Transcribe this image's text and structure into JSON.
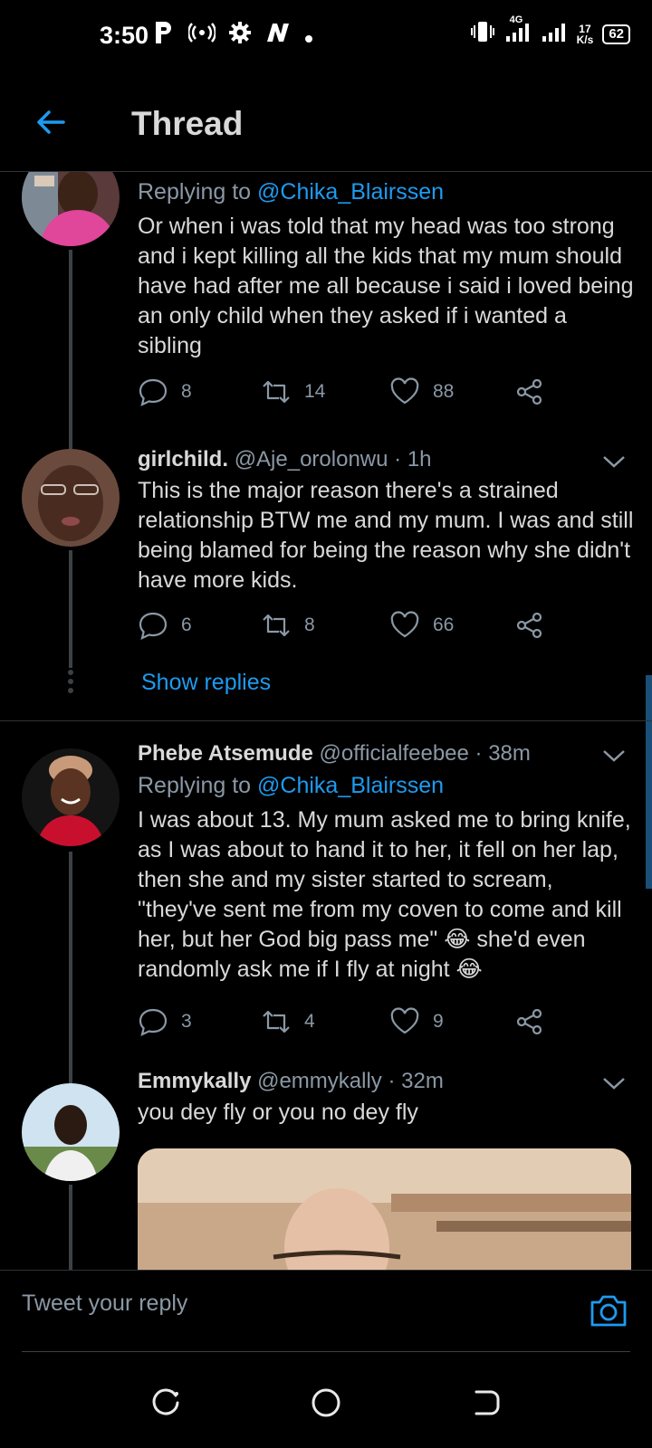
{
  "status_bar": {
    "time": "3:50",
    "network_speed_value": "17",
    "network_speed_unit": "K/s",
    "network_type": "4G",
    "battery": "62"
  },
  "header": {
    "title": "Thread"
  },
  "tweets": [
    {
      "replying_prefix": "Replying to ",
      "replying_to": "@Chika_Blairssen",
      "text": "Or when i was told that my head was too strong and i kept killing all the kids that my mum should have had after me all because i said i loved being an only child when they asked if i wanted a sibling",
      "replies": "8",
      "retweets": "14",
      "likes": "88"
    },
    {
      "name": "girlchild.",
      "handle": "@Aje_orolonwu",
      "time": "· 1h",
      "text": "This is the major reason there's a strained relationship BTW me and my mum. I was and still being blamed for being the reason why she didn't have more kids.",
      "replies": "6",
      "retweets": "8",
      "likes": "66",
      "show_replies": "Show replies"
    },
    {
      "name": "Phebe Atsemude",
      "handle": "@officialfeebee",
      "time": "· 38m",
      "replying_prefix": "Replying to ",
      "replying_to": "@Chika_Blairssen",
      "text": "I was about 13. My mum asked me to bring knife, as I was about to hand it to her, it fell on her lap, then she and my sister started to scream, \"they've sent me from my coven to come and kill her, but her God big pass me\" 😂 she'd even randomly ask me if I fly at night 😂",
      "replies": "3",
      "retweets": "4",
      "likes": "9"
    },
    {
      "name": "Emmykally",
      "handle": "@emmykally",
      "time": "· 32m",
      "text": "you dey fly or you no dey fly"
    }
  ],
  "reply_bar": {
    "placeholder": "Tweet your reply"
  },
  "colors": {
    "accent": "#1d9bf0",
    "background": "#000000",
    "secondary_text": "#8b98a5"
  }
}
